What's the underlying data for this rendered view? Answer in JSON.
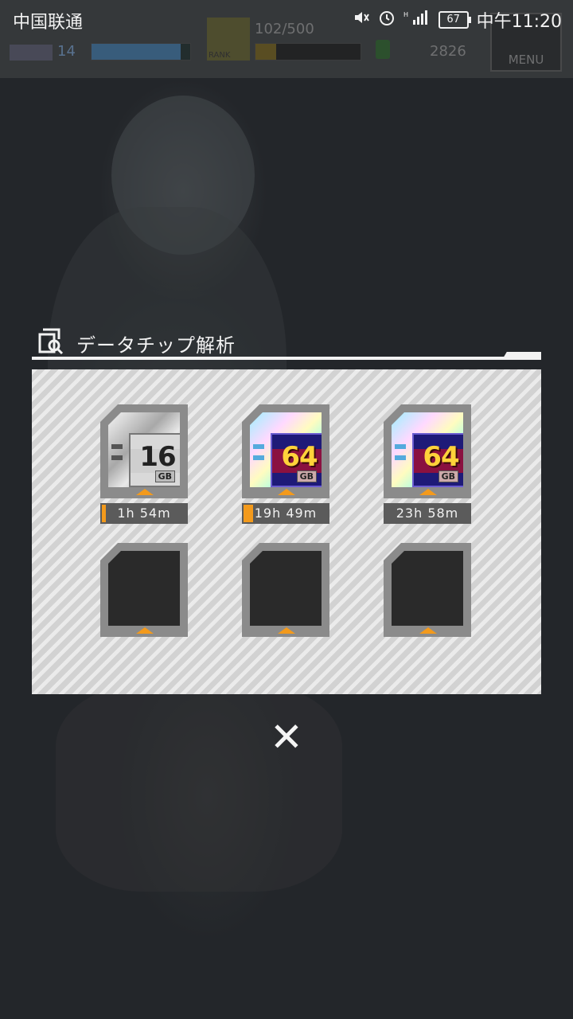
{
  "status_bar": {
    "carrier": "中国联通",
    "battery": "67",
    "time": "中午11:20",
    "icons": [
      "mute-icon",
      "alarm-icon",
      "signal-icon",
      "battery-icon"
    ]
  },
  "hud": {
    "level": "14",
    "rank_label": "RANK",
    "exp": "102/500",
    "coins": "2826",
    "menu_label": "MENU"
  },
  "modal": {
    "title": "データチップ解析",
    "close_label": "✕",
    "slots": [
      {
        "chip": "16",
        "unit": "GB",
        "style": "silver",
        "timer": "1h 54m"
      },
      {
        "chip": "64",
        "unit": "GB",
        "style": "holo",
        "timer": "19h 49m"
      },
      {
        "chip": "64",
        "unit": "GB",
        "style": "holo",
        "timer": "23h 58m"
      },
      {
        "chip": "",
        "unit": "",
        "style": "empty",
        "timer": ""
      },
      {
        "chip": "",
        "unit": "",
        "style": "empty",
        "timer": ""
      },
      {
        "chip": "",
        "unit": "",
        "style": "empty",
        "timer": ""
      }
    ]
  },
  "colors": {
    "accent": "#f39a1c",
    "panel": "#d2d2d2",
    "overlay": "#23262a"
  }
}
